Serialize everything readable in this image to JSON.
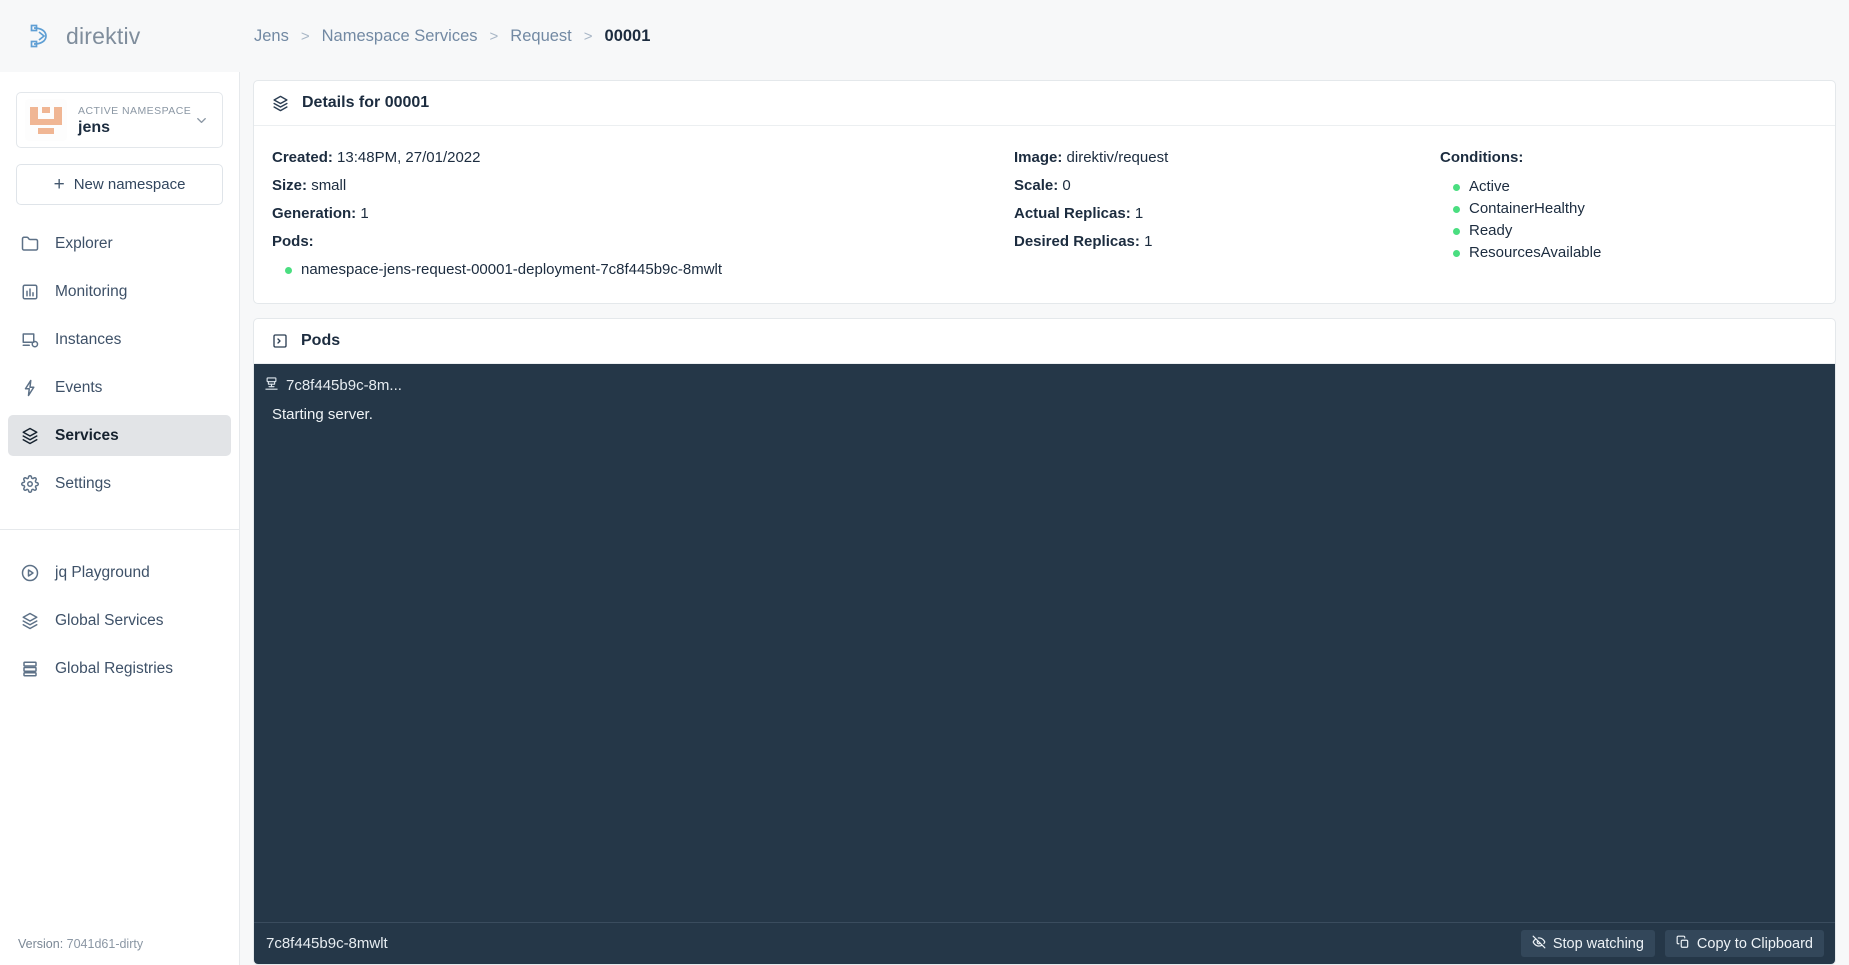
{
  "brand": {
    "name": "direktiv",
    "logo_icon": "direktiv-logo-icon"
  },
  "breadcrumb": [
    {
      "label": "Jens",
      "active": false
    },
    {
      "label": "Namespace Services",
      "active": false
    },
    {
      "label": "Request",
      "active": false
    },
    {
      "label": "00001",
      "active": true
    }
  ],
  "breadcrumb_separator": ">",
  "sidebar": {
    "namespace_selector": {
      "label": "ACTIVE NAMESPACE",
      "value": "jens",
      "chevron_icon": "chevron-down-icon",
      "avatar_icon": "namespace-identicon",
      "avatar_color": "#f0b694"
    },
    "new_namespace_button": {
      "label": "New namespace",
      "icon": "plus-icon"
    },
    "primary_items": [
      {
        "label": "Explorer",
        "icon": "folder-icon",
        "active": false
      },
      {
        "label": "Monitoring",
        "icon": "bar-chart-icon",
        "active": false
      },
      {
        "label": "Instances",
        "icon": "monitor-play-icon",
        "active": false
      },
      {
        "label": "Events",
        "icon": "lightning-icon",
        "active": false
      },
      {
        "label": "Services",
        "icon": "layers-icon",
        "active": true
      },
      {
        "label": "Settings",
        "icon": "gear-icon",
        "active": false
      }
    ],
    "secondary_items": [
      {
        "label": "jq Playground",
        "icon": "play-circle-icon",
        "active": false
      },
      {
        "label": "Global Services",
        "icon": "layers-icon",
        "active": false
      },
      {
        "label": "Global Registries",
        "icon": "server-icon",
        "active": false
      }
    ],
    "version_label": "Version:",
    "version_value": "7041d61-dirty"
  },
  "details_panel": {
    "title": "Details for 00001",
    "icon": "layers-icon",
    "column_1": [
      {
        "key": "Created:",
        "value": "13:48PM, 27/01/2022"
      },
      {
        "key": "Size:",
        "value": "small"
      },
      {
        "key": "Generation:",
        "value": "1"
      }
    ],
    "pods_key": "Pods:",
    "pods": [
      {
        "name": "namespace-jens-request-00001-deployment-7c8f445b9c-8mwlt",
        "status_color": "#4ade80"
      }
    ],
    "column_2": [
      {
        "key": "Image:",
        "value": "direktiv/request"
      },
      {
        "key": "Scale:",
        "value": "0"
      },
      {
        "key": "Actual Replicas:",
        "value": "1"
      },
      {
        "key": "Desired Replicas:",
        "value": "1"
      }
    ],
    "conditions_key": "Conditions:",
    "conditions": [
      {
        "label": "Active",
        "status_color": "#4ade80"
      },
      {
        "label": "ContainerHealthy",
        "status_color": "#4ade80"
      },
      {
        "label": "Ready",
        "status_color": "#4ade80"
      },
      {
        "label": "ResourcesAvailable",
        "status_color": "#4ade80"
      }
    ]
  },
  "pods_panel": {
    "title": "Pods",
    "icon": "terminal-square-icon",
    "terminal": {
      "background": "#253748",
      "tab_label": "7c8f445b9c-8m...",
      "tab_icon": "server-rack-icon",
      "log_lines": [
        "Starting server."
      ],
      "footer_name": "7c8f445b9c-8mwlt",
      "buttons": [
        {
          "label": "Stop watching",
          "icon": "eye-off-icon"
        },
        {
          "label": "Copy to Clipboard",
          "icon": "copy-icon"
        }
      ]
    }
  }
}
